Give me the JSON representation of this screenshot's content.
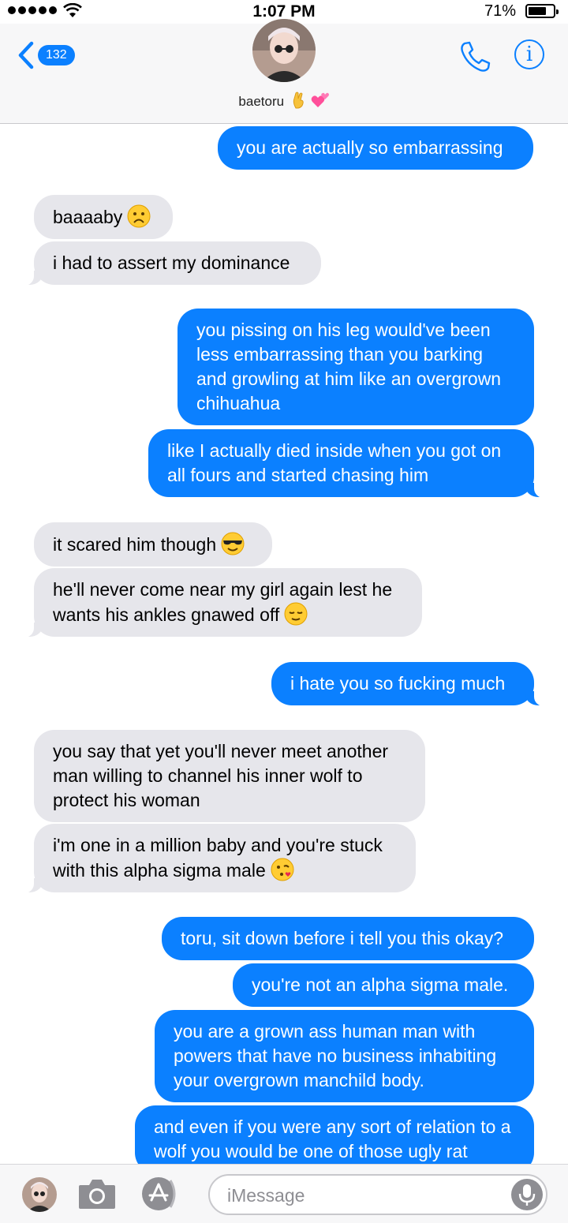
{
  "status": {
    "time": "1:07 PM",
    "battery": "71%",
    "battery_level": 0.71
  },
  "header": {
    "back_count": "132",
    "contact_name": "baetoru",
    "contact_emojis": [
      "crossed-fingers-hand",
      "two-hearts"
    ],
    "accent_color": "#0b80ff"
  },
  "messages": [
    {
      "from": "me",
      "text": "you are actually so embarrassing"
    },
    {
      "from": "them",
      "text": "baaaaby",
      "emoji": "frowning-face"
    },
    {
      "from": "them",
      "text": "i had to assert my dominance"
    },
    {
      "from": "me",
      "text": "you pissing on his leg would've been less embarrassing than you barking and growling at him like an overgrown chihuahua"
    },
    {
      "from": "me",
      "text": "like I actually died inside when you got on all fours and started chasing him"
    },
    {
      "from": "them",
      "text": "it scared him though",
      "emoji": "sunglasses-face"
    },
    {
      "from": "them",
      "text": "he'll never come near my girl again lest he wants his ankles gnawed off",
      "emoji": "relieved-face"
    },
    {
      "from": "me",
      "text": "i hate you so fucking much"
    },
    {
      "from": "them",
      "text": "you say that yet you'll never meet another man willing to channel his inner wolf to protect his woman"
    },
    {
      "from": "them",
      "text": "i'm one in a million baby and you're stuck with this alpha sigma male",
      "emoji": "kissing-heart-face"
    },
    {
      "from": "me",
      "text": "toru, sit down before i tell you this okay?"
    },
    {
      "from": "me",
      "text": "you're not an alpha sigma male."
    },
    {
      "from": "me",
      "text": "you are a grown ass human man with powers that have no business inhabiting your overgrown manchild body."
    },
    {
      "from": "me",
      "text": "and even if you were any sort of relation to a wolf you would be one of those ugly rat"
    }
  ],
  "input": {
    "placeholder": "iMessage"
  },
  "colors": {
    "sent_bubble": "#0b80ff",
    "received_bubble": "#e6e6eb"
  }
}
